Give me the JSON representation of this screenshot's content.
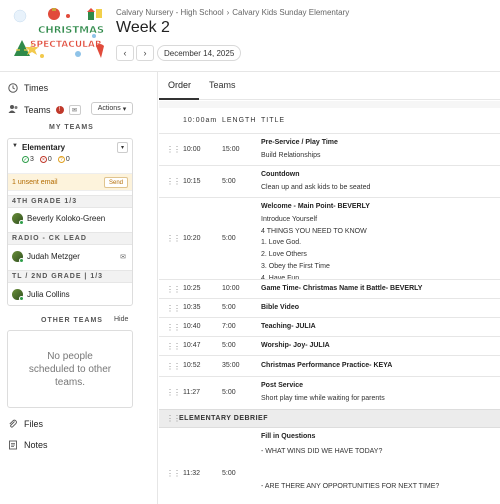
{
  "header": {
    "logo_text": "Christmas Spectacular",
    "breadcrumb": [
      "Calvary Nursery - High School",
      "Calvary Kids Sunday Elementary"
    ],
    "title": "Week 2",
    "prev_icon": "chevron-left",
    "next_icon": "chevron-right",
    "date": "December 14, 2025"
  },
  "sidebar": {
    "times_label": "Times",
    "teams_label": "Teams",
    "alert_badge": "!",
    "actions_label": "Actions",
    "my_teams_title": "MY TEAMS",
    "team": {
      "name": "Elementary",
      "stats": [
        {
          "icon": "check-circle-icon",
          "count": "3",
          "color": "#2e9e4a"
        },
        {
          "icon": "x-circle-icon",
          "count": "0",
          "color": "#c0392b"
        },
        {
          "icon": "question-circle-icon",
          "count": "0",
          "color": "#e0a020"
        }
      ],
      "unsent_text": "1 unsent email",
      "send_label": "Send",
      "positions": [
        {
          "name": "4TH GRADE 1/3",
          "people": [
            "Beverly Koloko-Green"
          ]
        },
        {
          "name": "RADIO - CK LEAD",
          "people": [
            "Judah Metzger"
          ]
        },
        {
          "name": "TL / 2ND GRADE | 1/3",
          "people": [
            "Julia Collins"
          ]
        }
      ]
    },
    "other_teams_title": "OTHER TEAMS",
    "hide_label": "Hide",
    "no_people_text": "No people scheduled to other teams.",
    "files_label": "Files",
    "notes_label": "Notes"
  },
  "main": {
    "tabs": [
      "Order",
      "Teams"
    ],
    "active_tab": "Order",
    "columns": {
      "start": "10:00am",
      "length": "LENGTH",
      "title": "TITLE"
    },
    "items": [
      {
        "time": "10:00",
        "length": "15:00",
        "title": "Pre-Service / Play Time",
        "desc": [
          "Build Relationships"
        ]
      },
      {
        "time": "10:15",
        "length": "5:00",
        "title": "Countdown",
        "desc": [
          "Clean up and ask kids to be seated"
        ]
      },
      {
        "time": "10:20",
        "length": "5:00",
        "title": "Welcome - Main Point- BEVERLY",
        "desc": [
          "Introduce Yourself",
          "4 THINGS YOU NEED TO KNOW",
          "1. Love God.",
          "2. Love Others",
          "3. Obey the First Time",
          "4. Have Fun"
        ]
      },
      {
        "time": "10:25",
        "length": "10:00",
        "title": "Game Time- Christmas Name it Battle- BEVERLY",
        "desc": []
      },
      {
        "time": "10:35",
        "length": "5:00",
        "title": "Bible Video",
        "desc": []
      },
      {
        "time": "10:40",
        "length": "7:00",
        "title": "Teaching- JULIA",
        "desc": []
      },
      {
        "time": "10:47",
        "length": "5:00",
        "title": "Worship- Joy- JULIA",
        "desc": []
      },
      {
        "time": "10:52",
        "length": "35:00",
        "title": "Christmas Performance Practice- KEYA",
        "desc": []
      },
      {
        "time": "11:27",
        "length": "5:00",
        "title": "Post Service",
        "desc": [
          "Short play time while waiting for parents"
        ]
      }
    ],
    "section_header": "ELEMENTARY DEBRIEF",
    "debrief": {
      "time": "11:32",
      "length": "5:00",
      "title": "Fill in Questions",
      "desc": [
        "- WHAT WINS DID WE HAVE TODAY?",
        "",
        "",
        "- ARE THERE ANY OPPORTUNITIES FOR NEXT TIME?"
      ]
    }
  }
}
